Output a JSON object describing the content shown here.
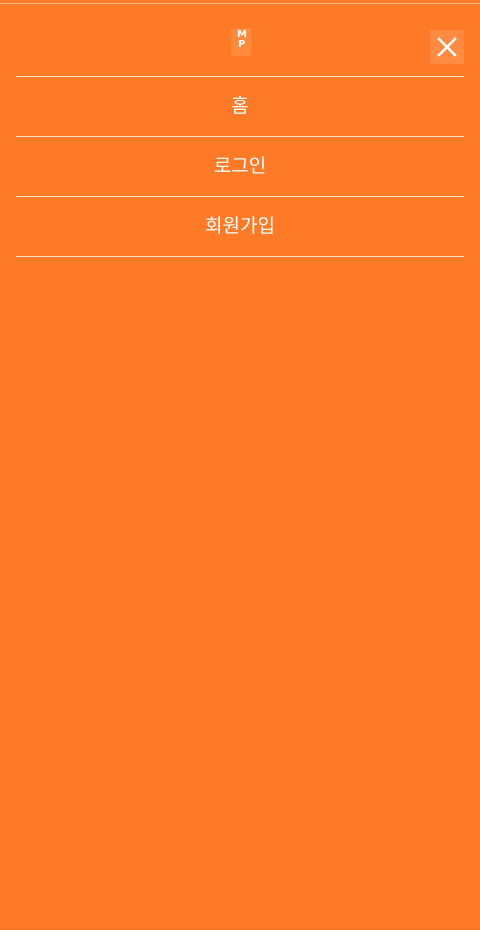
{
  "app": {
    "theme_color": "#ff7a27"
  },
  "header": {
    "logo_top": "M",
    "logo_bottom": "P",
    "close_icon": "close-icon"
  },
  "menu": {
    "items": [
      {
        "label": "홈"
      },
      {
        "label": "로그인"
      },
      {
        "label": "회원가입"
      }
    ]
  }
}
